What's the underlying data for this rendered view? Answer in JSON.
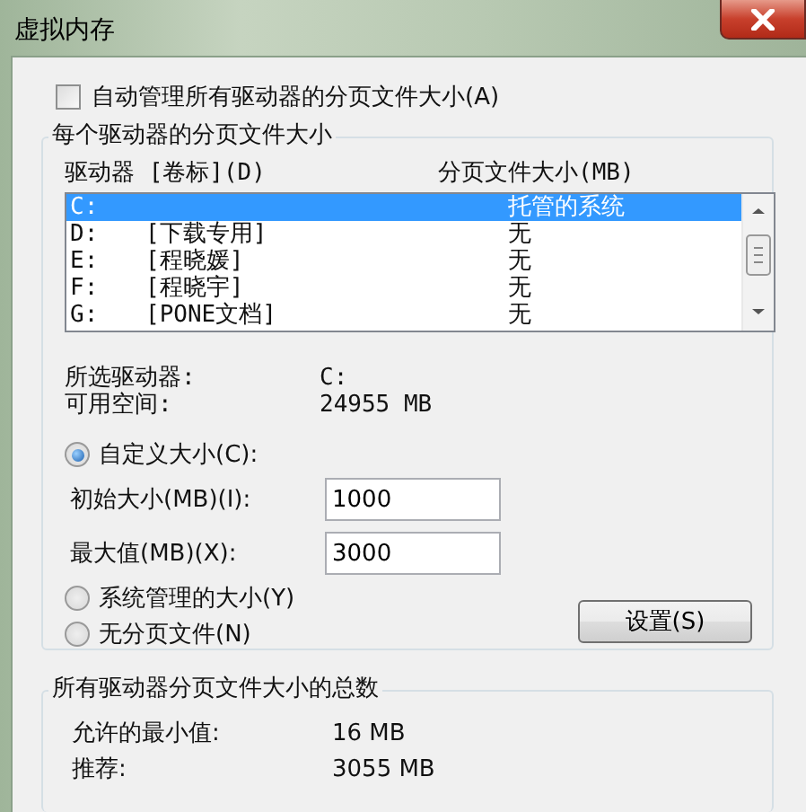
{
  "window": {
    "title": "虚拟内存"
  },
  "auto_manage": {
    "label": "自动管理所有驱动器的分页文件大小(A)",
    "checked": false
  },
  "per_drive": {
    "title": "每个驱动器的分页文件大小",
    "columns": [
      "驱动器 [卷标](D)",
      "分页文件大小(MB)"
    ],
    "rows": [
      {
        "drive": "C:",
        "volume": "",
        "size": "托管的系统",
        "selected": true
      },
      {
        "drive": "D:",
        "volume": "[下载专用]",
        "size": "无",
        "selected": false
      },
      {
        "drive": "E:",
        "volume": "[程晓媛]",
        "size": "无",
        "selected": false
      },
      {
        "drive": "F:",
        "volume": "[程晓宇]",
        "size": "无",
        "selected": false
      },
      {
        "drive": "G:",
        "volume": "[PONE文档]",
        "size": "无",
        "selected": false
      }
    ],
    "info": [
      {
        "label": "所选驱动器:",
        "value": "C:"
      },
      {
        "label": "可用空间:",
        "value": "24955 MB"
      }
    ],
    "options": [
      {
        "kind": "radio",
        "label": "自定义大小(C):",
        "selected": true
      },
      {
        "kind": "field",
        "label": "初始大小(MB)(I):",
        "value": "1000"
      },
      {
        "kind": "field",
        "label": "最大值(MB)(X):",
        "value": "3000"
      },
      {
        "kind": "radio",
        "label": "系统管理的大小(Y)",
        "selected": false
      },
      {
        "kind": "radio",
        "label": "无分页文件(N)",
        "selected": false
      }
    ],
    "set_button": "设置(S)"
  },
  "totals": {
    "title": "所有驱动器分页文件大小的总数",
    "rows": [
      {
        "label": "允许的最小值:",
        "value": "16 MB"
      },
      {
        "label": "推荐:",
        "value": "3055 MB"
      }
    ]
  }
}
